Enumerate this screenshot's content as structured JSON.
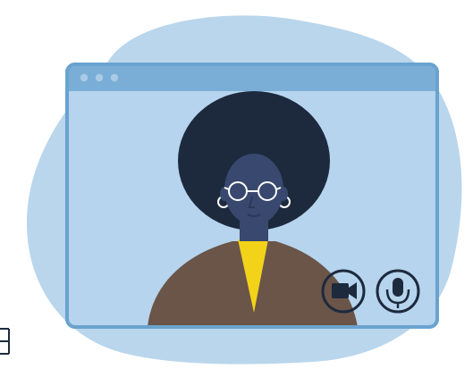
{
  "illustration": {
    "window_dots": [
      "dot-1",
      "dot-2",
      "dot-3"
    ],
    "controls": [
      {
        "name": "camera",
        "icon": "video-camera-icon"
      },
      {
        "name": "microphone",
        "icon": "microphone-icon"
      }
    ]
  },
  "colors": {
    "blob": "#b9d6ec",
    "window_bg": "#b6d4ed",
    "window_border": "#6aa3cf",
    "titlebar": "#7aaed6",
    "titlebar_dots": "#a9cbe6",
    "hair": "#1d2a3e",
    "skin": "#38486e",
    "jacket": "#6a5548",
    "shirt": "#f3d21a",
    "icon_stroke": "#1d2a3e",
    "earring": "#ffffff",
    "glasses": "#ffffff",
    "bracket": "#1d2a3e"
  }
}
